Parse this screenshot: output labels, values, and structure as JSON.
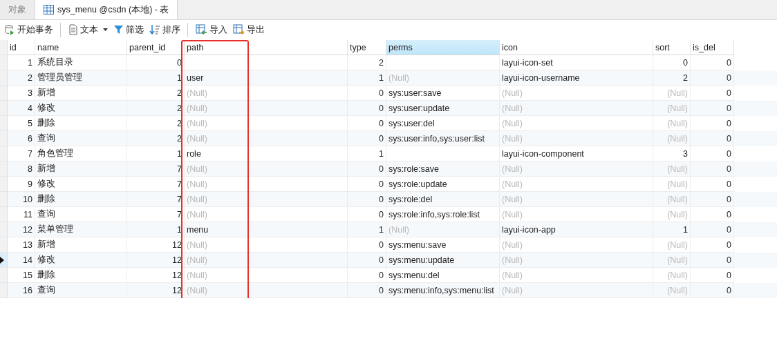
{
  "tabs": [
    {
      "label": "对象",
      "selected": false,
      "icon": false
    },
    {
      "label": "sys_menu @csdn (本地) - 表",
      "selected": true,
      "icon": true
    }
  ],
  "toolbar": [
    {
      "label": "开始事务",
      "kind": "transaction",
      "dropdown": false,
      "separator_after": true
    },
    {
      "label": "文本",
      "kind": "text",
      "dropdown": true,
      "separator_after": false
    },
    {
      "label": "筛选",
      "kind": "filter",
      "dropdown": false,
      "separator_after": false
    },
    {
      "label": "排序",
      "kind": "sort",
      "dropdown": false,
      "separator_after": true
    },
    {
      "label": "导入",
      "kind": "import",
      "dropdown": false,
      "separator_after": false
    },
    {
      "label": "导出",
      "kind": "export",
      "dropdown": false,
      "separator_after": false
    }
  ],
  "table": {
    "columns": [
      {
        "label": "id",
        "numeric": true,
        "selected": false,
        "highlighted": false
      },
      {
        "label": "name",
        "numeric": false,
        "selected": false,
        "highlighted": false
      },
      {
        "label": "parent_id",
        "numeric": true,
        "selected": false,
        "highlighted": false
      },
      {
        "label": "path",
        "numeric": false,
        "selected": false,
        "highlighted": true
      },
      {
        "label": "type",
        "numeric": true,
        "selected": false,
        "highlighted": false
      },
      {
        "label": "perms",
        "numeric": false,
        "selected": true,
        "highlighted": false
      },
      {
        "label": "icon",
        "numeric": false,
        "selected": false,
        "highlighted": false
      },
      {
        "label": "sort",
        "numeric": true,
        "selected": false,
        "highlighted": false
      },
      {
        "label": "is_del",
        "numeric": true,
        "selected": false,
        "highlighted": false
      }
    ],
    "rows": [
      {
        "current": false,
        "cells": [
          "1",
          "系统目录",
          "0",
          null,
          "2",
          null,
          "layui-icon-set",
          "0",
          "0"
        ]
      },
      {
        "current": false,
        "cells": [
          "2",
          "管理员管理",
          "1",
          "user",
          "1",
          {
            "null_text": "(Null)"
          },
          "layui-icon-username",
          "2",
          "0"
        ]
      },
      {
        "current": false,
        "cells": [
          "3",
          "新增",
          "2",
          {
            "null_text": "(Null)"
          },
          "0",
          "sys:user:save",
          {
            "null_text": "(Null)"
          },
          {
            "null_text": "(Null)"
          },
          "0"
        ]
      },
      {
        "current": false,
        "cells": [
          "4",
          "修改",
          "2",
          {
            "null_text": "(Null)"
          },
          "0",
          "sys:user:update",
          {
            "null_text": "(Null)"
          },
          {
            "null_text": "(Null)"
          },
          "0"
        ]
      },
      {
        "current": false,
        "cells": [
          "5",
          "删除",
          "2",
          {
            "null_text": "(Null)"
          },
          "0",
          "sys:user:del",
          {
            "null_text": "(Null)"
          },
          {
            "null_text": "(Null)"
          },
          "0"
        ]
      },
      {
        "current": false,
        "cells": [
          "6",
          "查询",
          "2",
          {
            "null_text": "(Null)"
          },
          "0",
          "sys:user:info,sys:user:list",
          {
            "null_text": "(Null)"
          },
          {
            "null_text": "(Null)"
          },
          "0"
        ]
      },
      {
        "current": false,
        "cells": [
          "7",
          "角色管理",
          "1",
          "role",
          "1",
          null,
          "layui-icon-component",
          "3",
          "0"
        ]
      },
      {
        "current": false,
        "cells": [
          "8",
          "新增",
          "7",
          {
            "null_text": "(Null)"
          },
          "0",
          "sys:role:save",
          {
            "null_text": "(Null)"
          },
          {
            "null_text": "(Null)"
          },
          "0"
        ]
      },
      {
        "current": false,
        "cells": [
          "9",
          "修改",
          "7",
          {
            "null_text": "(Null)"
          },
          "0",
          "sys:role:update",
          {
            "null_text": "(Null)"
          },
          {
            "null_text": "(Null)"
          },
          "0"
        ]
      },
      {
        "current": false,
        "cells": [
          "10",
          "删除",
          "7",
          {
            "null_text": "(Null)"
          },
          "0",
          "sys:role:del",
          {
            "null_text": "(Null)"
          },
          {
            "null_text": "(Null)"
          },
          "0"
        ]
      },
      {
        "current": false,
        "cells": [
          "11",
          "查询",
          "7",
          {
            "null_text": "(Null)"
          },
          "0",
          "sys:role:info,sys:role:list",
          {
            "null_text": "(Null)"
          },
          {
            "null_text": "(Null)"
          },
          "0"
        ]
      },
      {
        "current": false,
        "cells": [
          "12",
          "菜单管理",
          "1",
          "menu",
          "1",
          {
            "null_text": "(Null)"
          },
          "layui-icon-app",
          "1",
          "0"
        ]
      },
      {
        "current": false,
        "cells": [
          "13",
          "新增",
          "12",
          {
            "null_text": "(Null)"
          },
          "0",
          "sys:menu:save",
          {
            "null_text": "(Null)"
          },
          {
            "null_text": "(Null)"
          },
          "0"
        ]
      },
      {
        "current": true,
        "cells": [
          "14",
          "修改",
          "12",
          {
            "null_text": "(Null)"
          },
          "0",
          "sys:menu:update",
          {
            "null_text": "(Null)"
          },
          {
            "null_text": "(Null)"
          },
          "0"
        ]
      },
      {
        "current": false,
        "cells": [
          "15",
          "删除",
          "12",
          {
            "null_text": "(Null)"
          },
          "0",
          "sys:menu:del",
          {
            "null_text": "(Null)"
          },
          {
            "null_text": "(Null)"
          },
          "0"
        ]
      },
      {
        "current": false,
        "cells": [
          "16",
          "查询",
          "12",
          {
            "null_text": "(Null)"
          },
          "0",
          "sys:menu:info,sys:menu:list",
          {
            "null_text": "(Null)"
          },
          {
            "null_text": "(Null)"
          },
          "0"
        ]
      }
    ]
  }
}
